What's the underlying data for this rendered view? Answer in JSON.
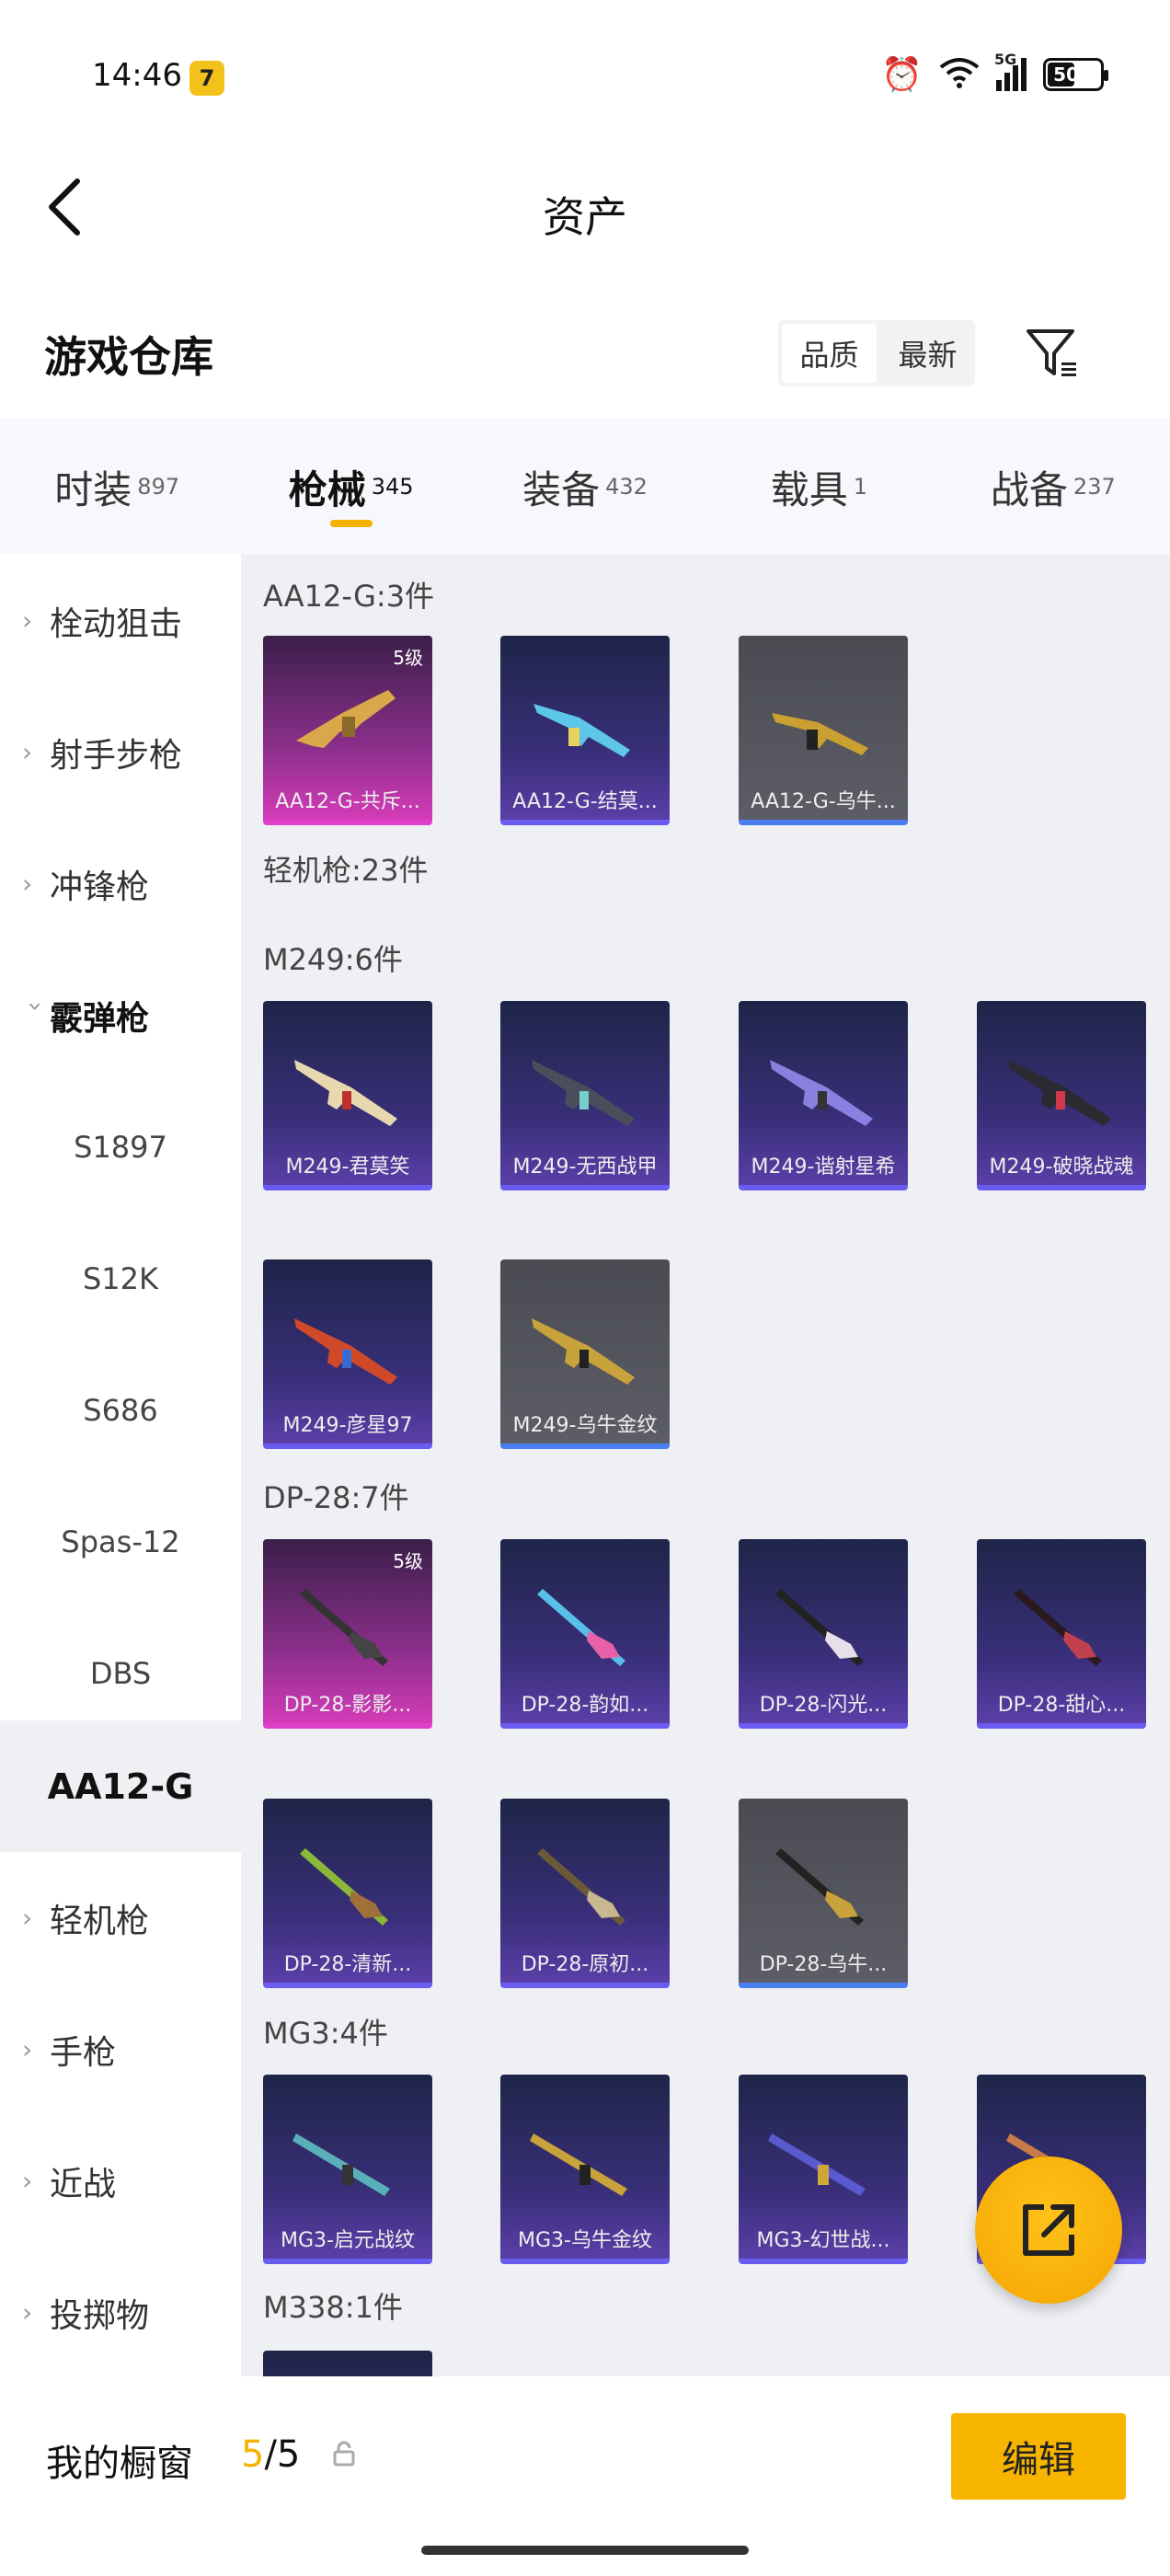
{
  "status": {
    "time": "14:46",
    "battery": "50",
    "network": "5G"
  },
  "header": {
    "title": "资产"
  },
  "warehouse": {
    "title": "游戏仓库",
    "sort_quality": "品质",
    "sort_newest": "最新"
  },
  "tabs": [
    {
      "label": "时装",
      "count": "897"
    },
    {
      "label": "枪械",
      "count": "345"
    },
    {
      "label": "装备",
      "count": "432"
    },
    {
      "label": "载具",
      "count": "1"
    },
    {
      "label": "战备",
      "count": "237"
    }
  ],
  "sidebar": {
    "items": [
      {
        "label": "栓动狙击"
      },
      {
        "label": "射手步枪"
      },
      {
        "label": "冲锋枪"
      },
      {
        "label": "霰弹枪"
      },
      {
        "label": "S1897"
      },
      {
        "label": "S12K"
      },
      {
        "label": "S686"
      },
      {
        "label": "Spas-12"
      },
      {
        "label": "DBS"
      },
      {
        "label": "AA12-G"
      },
      {
        "label": "轻机枪"
      },
      {
        "label": "手枪"
      },
      {
        "label": "近战"
      },
      {
        "label": "投掷物"
      }
    ]
  },
  "groups": {
    "aa12": {
      "title": "AA12-G:3件"
    },
    "lmg": {
      "title": "轻机枪:23件"
    },
    "m249": {
      "title": "M249:6件"
    },
    "dp28": {
      "title": "DP-28:7件"
    },
    "mg3": {
      "title": "MG3:4件"
    },
    "m338": {
      "title": "M338:1件"
    }
  },
  "cards": {
    "aa12_1": {
      "name": "AA12-G-共斥...",
      "level": "5级"
    },
    "aa12_2": {
      "name": "AA12-G-结莫..."
    },
    "aa12_3": {
      "name": "AA12-G-乌牛..."
    },
    "m249_1": {
      "name": "M249-君莫笑"
    },
    "m249_2": {
      "name": "M249-无西战甲"
    },
    "m249_3": {
      "name": "M249-谐射星希"
    },
    "m249_4": {
      "name": "M249-破晓战魂"
    },
    "m249_5": {
      "name": "M249-彦星97"
    },
    "m249_6": {
      "name": "M249-乌牛金纹"
    },
    "dp28_1": {
      "name": "DP-28-影影...",
      "level": "5级"
    },
    "dp28_2": {
      "name": "DP-28-韵如..."
    },
    "dp28_3": {
      "name": "DP-28-闪光..."
    },
    "dp28_4": {
      "name": "DP-28-甜心..."
    },
    "dp28_5": {
      "name": "DP-28-清新..."
    },
    "dp28_6": {
      "name": "DP-28-原初..."
    },
    "dp28_7": {
      "name": "DP-28-乌牛..."
    },
    "mg3_1": {
      "name": "MG3-启元战纹"
    },
    "mg3_2": {
      "name": "MG3-乌牛金纹"
    },
    "mg3_3": {
      "name": "MG3-幻世战..."
    }
  },
  "bottom": {
    "showcase_label": "我的橱窗",
    "count_current": "5",
    "count_total": "/5",
    "edit_label": "编辑"
  },
  "colors": {
    "accent": "#f5b301",
    "content_bg": "#eef0f4"
  }
}
